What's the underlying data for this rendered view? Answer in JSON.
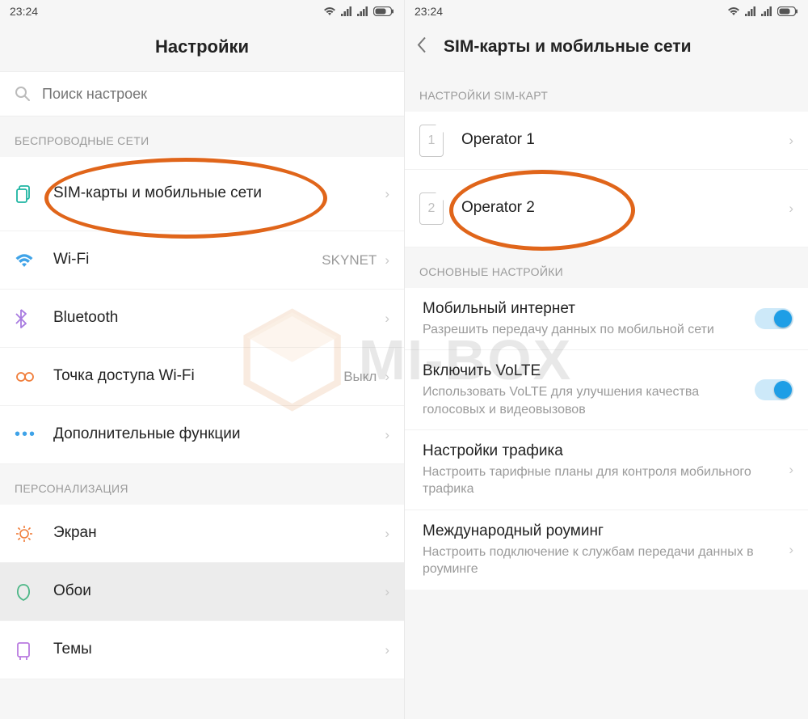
{
  "statusbar": {
    "time": "23:24"
  },
  "left": {
    "title": "Настройки",
    "search_placeholder": "Поиск настроек",
    "section_wireless": "БЕСПРОВОДНЫЕ СЕТИ",
    "section_personalization": "ПЕРСОНАЛИЗАЦИЯ",
    "rows": {
      "sim": "SIM-карты и мобильные сети",
      "wifi": "Wi-Fi",
      "wifi_value": "SKYNET",
      "bluetooth": "Bluetooth",
      "hotspot": "Точка доступа Wi-Fi",
      "hotspot_value": "Выкл",
      "more": "Дополнительные функции",
      "display": "Экран",
      "wallpaper": "Обои",
      "themes": "Темы"
    }
  },
  "right": {
    "title": "SIM-карты и мобильные сети",
    "section_sims": "НАСТРОЙКИ SIM-КАРТ",
    "section_main": "ОСНОВНЫЕ НАСТРОЙКИ",
    "sim1": {
      "num": "1",
      "name": "Operator 1"
    },
    "sim2": {
      "num": "2",
      "name": "Operator 2"
    },
    "mobile_data": {
      "title": "Мобильный интернет",
      "sub": "Разрешить передачу данных по мобильной сети"
    },
    "volte": {
      "title": "Включить VoLTE",
      "sub": "Использовать VoLTE для улучшения качества голосовых и видеовызовов"
    },
    "traffic": {
      "title": "Настройки трафика",
      "sub": "Настроить тарифные планы для контроля мобильного трафика"
    },
    "roaming": {
      "title": "Международный роуминг",
      "sub": "Настроить подключение к службам передачи данных в роуминге"
    }
  },
  "watermark": "MI-BOX"
}
